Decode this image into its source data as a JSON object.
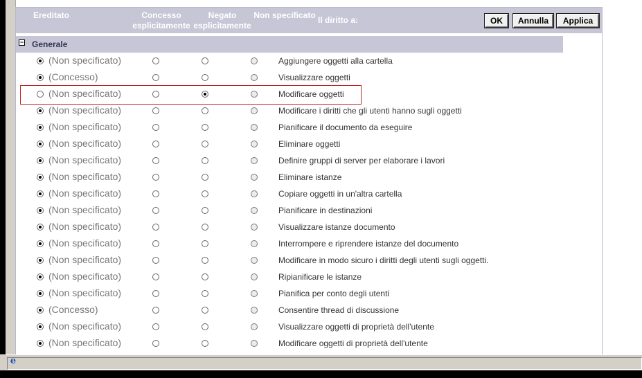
{
  "header": {
    "col_ereditato": "Ereditato",
    "col_concesso": "Concesso esplicitamente",
    "col_negato": "Negato esplicitamente",
    "col_nonspec": "Non specificato",
    "col_diritto": "Il diritto a:",
    "ok_label": "OK",
    "annulla_label": "Annulla",
    "applica_label": "Applica"
  },
  "section": {
    "toggle": "−",
    "title": "Generale"
  },
  "rows": [
    {
      "inherited": "(Non specificato)",
      "right": "Aggiungere oggetti alla cartella",
      "selected": "inh"
    },
    {
      "inherited": "(Concesso)",
      "right": "Visualizzare oggetti",
      "selected": "inh"
    },
    {
      "inherited": "(Non specificato)",
      "right": "Modificare oggetti",
      "selected": "neg"
    },
    {
      "inherited": "(Non specificato)",
      "right": "Modificare i diritti che gli utenti hanno sugli oggetti",
      "selected": "inh"
    },
    {
      "inherited": "(Non specificato)",
      "right": "Pianificare il documento da eseguire",
      "selected": "inh"
    },
    {
      "inherited": "(Non specificato)",
      "right": "Eliminare oggetti",
      "selected": "inh"
    },
    {
      "inherited": "(Non specificato)",
      "right": "Definire gruppi di server per elaborare i lavori",
      "selected": "inh"
    },
    {
      "inherited": "(Non specificato)",
      "right": "Eliminare istanze",
      "selected": "inh"
    },
    {
      "inherited": "(Non specificato)",
      "right": "Copiare oggetti in un'altra cartella",
      "selected": "inh"
    },
    {
      "inherited": "(Non specificato)",
      "right": "Pianificare in destinazioni",
      "selected": "inh"
    },
    {
      "inherited": "(Non specificato)",
      "right": "Visualizzare istanze documento",
      "selected": "inh"
    },
    {
      "inherited": "(Non specificato)",
      "right": "Interrompere e riprendere istanze del documento",
      "selected": "inh"
    },
    {
      "inherited": "(Non specificato)",
      "right": "Modificare in modo sicuro i diritti degli utenti sugli oggetti.",
      "selected": "inh"
    },
    {
      "inherited": "(Non specificato)",
      "right": "Ripianificare le istanze",
      "selected": "inh"
    },
    {
      "inherited": "(Non specificato)",
      "right": "Pianifica per conto degli utenti",
      "selected": "inh"
    },
    {
      "inherited": "(Concesso)",
      "right": "Consentire thread di discussione",
      "selected": "inh"
    },
    {
      "inherited": "(Non specificato)",
      "right": "Visualizzare oggetti di proprietà dell'utente",
      "selected": "inh"
    },
    {
      "inherited": "(Non specificato)",
      "right": "Modificare oggetti di proprietà dell'utente",
      "selected": "inh"
    }
  ],
  "statusbar": {
    "icon": "ie-page-icon",
    "glyph": "e"
  }
}
